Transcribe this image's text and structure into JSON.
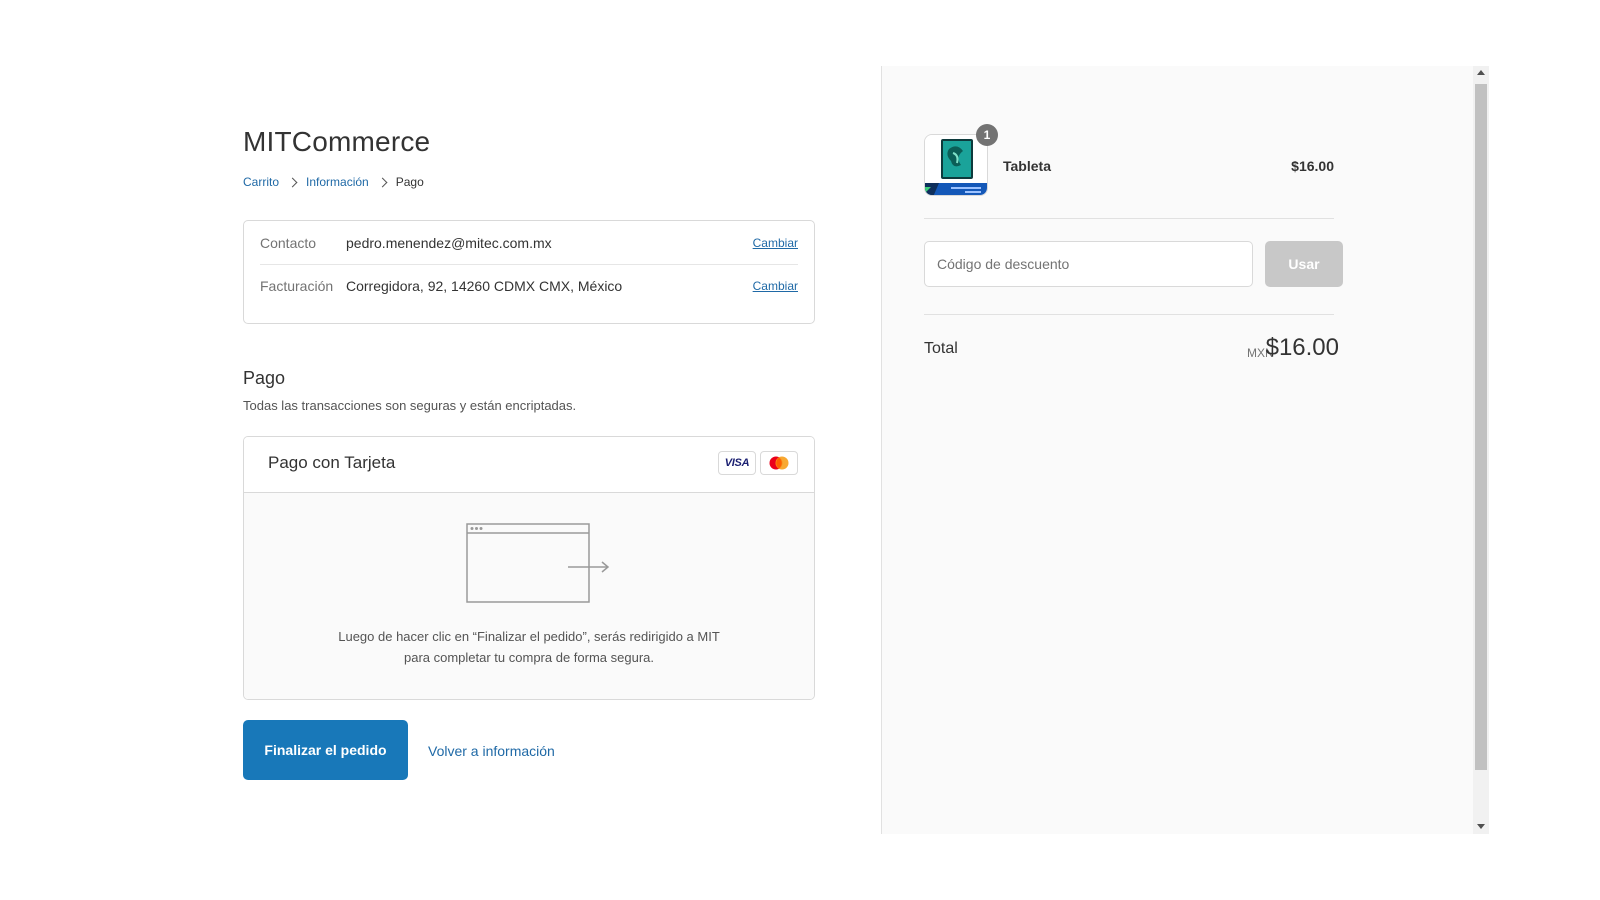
{
  "store": {
    "name": "MITCommerce"
  },
  "breadcrumb": [
    {
      "label": "Carrito"
    },
    {
      "label": "Información"
    },
    {
      "label": "Pago"
    }
  ],
  "review": {
    "contact": {
      "label": "Contacto",
      "value": "pedro.menendez@mitec.com.mx",
      "change": "Cambiar"
    },
    "billing": {
      "label": "Facturación",
      "value": "Corregidora, 92, 14260 CDMX CMX, México",
      "change": "Cambiar"
    }
  },
  "payment": {
    "title": "Pago",
    "subtitle": "Todas las transacciones son seguras y están encriptadas.",
    "method_title": "Pago con Tarjeta",
    "cards": [
      "visa-icon",
      "mastercard-icon"
    ],
    "visa_text": "VISA",
    "redirect_line1": "Luego de hacer clic en “Finalizar el pedido”, serás redirigido a MIT",
    "redirect_line2": "para completar tu compra de forma segura."
  },
  "actions": {
    "complete": "Finalizar el pedido",
    "back": "Volver a información"
  },
  "summary": {
    "product": {
      "name": "Tableta",
      "price": "$16.00",
      "quantity": "1"
    },
    "discount": {
      "placeholder": "Código de descuento",
      "apply": "Usar"
    },
    "total": {
      "label": "Total",
      "currency": "MXN",
      "value": "$16.00"
    }
  },
  "colors": {
    "accent": "#1878b9",
    "link": "#1f69a6",
    "disabled_button": "#c8c8c8"
  }
}
